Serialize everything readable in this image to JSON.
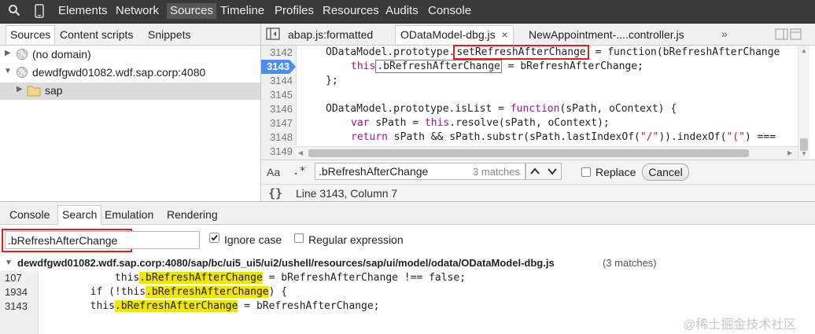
{
  "toolbar": {
    "tabs": [
      "Elements",
      "Network",
      "Sources",
      "Timeline",
      "Profiles",
      "Resources",
      "Audits",
      "Console"
    ],
    "active_tab": "Sources"
  },
  "navigator": {
    "tabs": [
      "Sources",
      "Content scripts",
      "Snippets"
    ],
    "tree": [
      "(no domain)",
      "dewdfgwd01082.wdf.sap.corp:4080",
      "sap"
    ]
  },
  "editor": {
    "tabs": [
      "abap.js:formatted",
      "OData‌Model-dbg.js",
      "NewAppointment-....controller.js"
    ],
    "tab_close": "×",
    "tab_overflow": "»",
    "line_numbers": [
      "3142",
      "3143",
      "3144",
      "3145",
      "3146",
      "3147",
      "3148",
      "3149"
    ],
    "lines": {
      "l1_pre": "ODataModel.prototype.",
      "l1_name": "setRefreshAfterChange",
      "l1_post": " = function(bRefreshAfterChange",
      "l2_kw": "this",
      "l2_box": ".bRefreshAfterChange",
      "l2_post": " = bRefreshAfterChange;",
      "l3": "};",
      "l5_pre": "ODataModel.prototype.isList = ",
      "l5_kw": "function",
      "l5_post": "(sPath, oContext) {",
      "l6_kw": "var",
      "l6_mid": " sPath = ",
      "l6_kw2": "this",
      "l6_post": ".resolve(sPath, oContext);",
      "l7_kw": "return",
      "l7_pre": " sPath && sPath.substr(sPath.lastIndexOf(",
      "l7_str1": "\"/\"",
      "l7_mid": ")).indexOf(",
      "l7_str2": "\"(\"",
      "l7_post": ") ==="
    }
  },
  "findbar": {
    "case_label": "Aa",
    "regex_label": ".*",
    "query": ".bRefreshAfterChange",
    "matches": "3 matches",
    "replace_label": "Replace",
    "cancel_label": "Cancel"
  },
  "status": {
    "format_icon": "{}",
    "position": "Line 3143, Column 7"
  },
  "drawer": {
    "tabs": [
      "Console",
      "Search",
      "Emulation",
      "Rendering"
    ],
    "search_query": ".bRefreshAfterChange",
    "ignore_case_label": "Ignore case",
    "regex_label": "Regular expression",
    "file_path": "dewdfgwd01082.wdf.sap.corp:4080/sap/bc/ui5_ui5/ui2/ushell/resources/sap/ui/model/odata/ODataModel-dbg.js",
    "file_matches": "(3 matches)",
    "results": [
      {
        "line": "107",
        "pre": "            this",
        "match": ".bRefreshAfterChange",
        "post": " = bRefreshAfterChange !== false;"
      },
      {
        "line": "1934",
        "pre": "        if (!this",
        "match": ".bRefreshAfterChange",
        "post": ") {"
      },
      {
        "line": "3143",
        "pre": "        this",
        "match": ".bRefreshAfterChange",
        "post": " = bRefreshAfterChange;"
      }
    ]
  },
  "watermark": "@稀土掘金技术社区"
}
